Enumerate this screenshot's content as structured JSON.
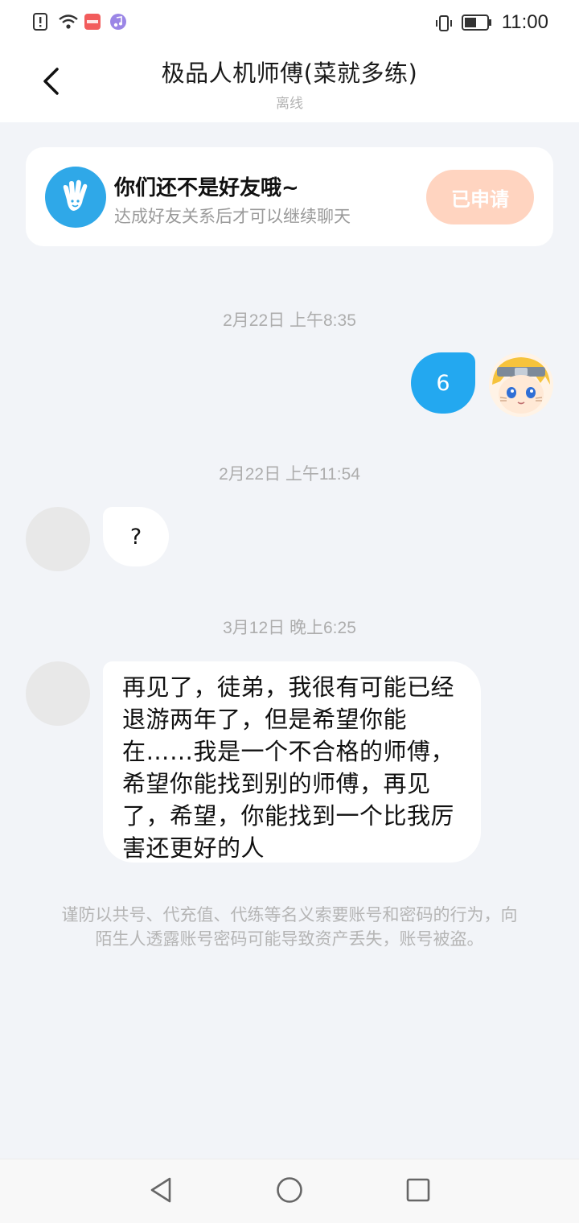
{
  "status_bar": {
    "time": "11:00",
    "icons": [
      "alert-icon",
      "wifi-icon",
      "app-badge-icon",
      "music-icon",
      "vibrate-icon",
      "battery-icon"
    ]
  },
  "header": {
    "back_icon": "chevron-left-icon",
    "title": "极品人机师傅(菜就多练)",
    "status": "离线"
  },
  "friend_card": {
    "title": "你们还不是好友哦~",
    "subtitle": "达成好友关系后才可以继续聊天",
    "button_label": "已申请",
    "button_color": "#ffd4c0"
  },
  "messages": [
    {
      "timestamp": "2月22日 上午8:35",
      "sender": "me",
      "text": "6"
    },
    {
      "timestamp": "2月22日 上午11:54",
      "sender": "other",
      "text": "?"
    },
    {
      "timestamp": "3月12日 晚上6:25",
      "sender": "other",
      "text": "再见了，徒弟，我很有可能已经退游两年了，但是希望你能在……我是一个不合格的师傅，希望你能找到别的师傅，再见了，希望，你能找到一个比我厉害还更好的人"
    }
  ],
  "notice": "谨防以共号、代充值、代练等名义索要账号和密码的行为，向陌生人透露账号密码可能导致资产丢失，账号被盗。",
  "nav_bar": {
    "icons": [
      "back-triangle-icon",
      "home-circle-icon",
      "recent-square-icon"
    ]
  },
  "colors": {
    "accent": "#23a8f0",
    "background": "#f2f4f8"
  }
}
